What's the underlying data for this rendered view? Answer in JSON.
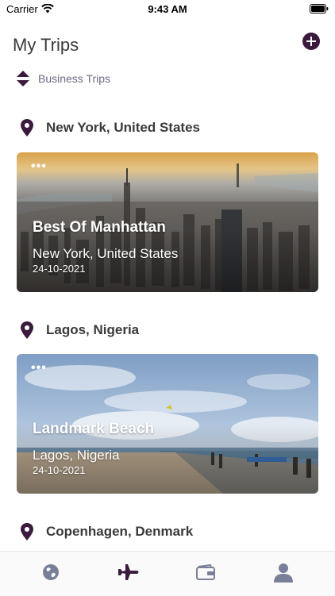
{
  "status_bar": {
    "carrier": "Carrier",
    "time": "9:43 AM"
  },
  "header": {
    "title": "My Trips",
    "add_icon": "plus-circle-icon"
  },
  "filter": {
    "label": "Business Trips",
    "icon": "sort-up-down-icon"
  },
  "sections": [
    {
      "location": "New York, United States",
      "card": {
        "title": "Best Of Manhattan",
        "subtitle": "New York, United States",
        "date": "24-10-2021",
        "menu": "•••"
      }
    },
    {
      "location": "Lagos, Nigeria",
      "card": {
        "title": "Landmark Beach",
        "subtitle": "Lagos, Nigeria",
        "date": "24-10-2021",
        "menu": "•••"
      }
    },
    {
      "location": "Copenhagen, Denmark"
    }
  ],
  "tabs": [
    {
      "name": "explore",
      "icon": "globe-icon",
      "active": false
    },
    {
      "name": "trips",
      "icon": "airplane-icon",
      "active": true
    },
    {
      "name": "wallet",
      "icon": "wallet-icon",
      "active": false
    },
    {
      "name": "profile",
      "icon": "user-icon",
      "active": false
    }
  ],
  "colors": {
    "accent": "#3b1a3d",
    "inactive_tab": "#7a7f99",
    "muted_text": "#6a6a85"
  }
}
